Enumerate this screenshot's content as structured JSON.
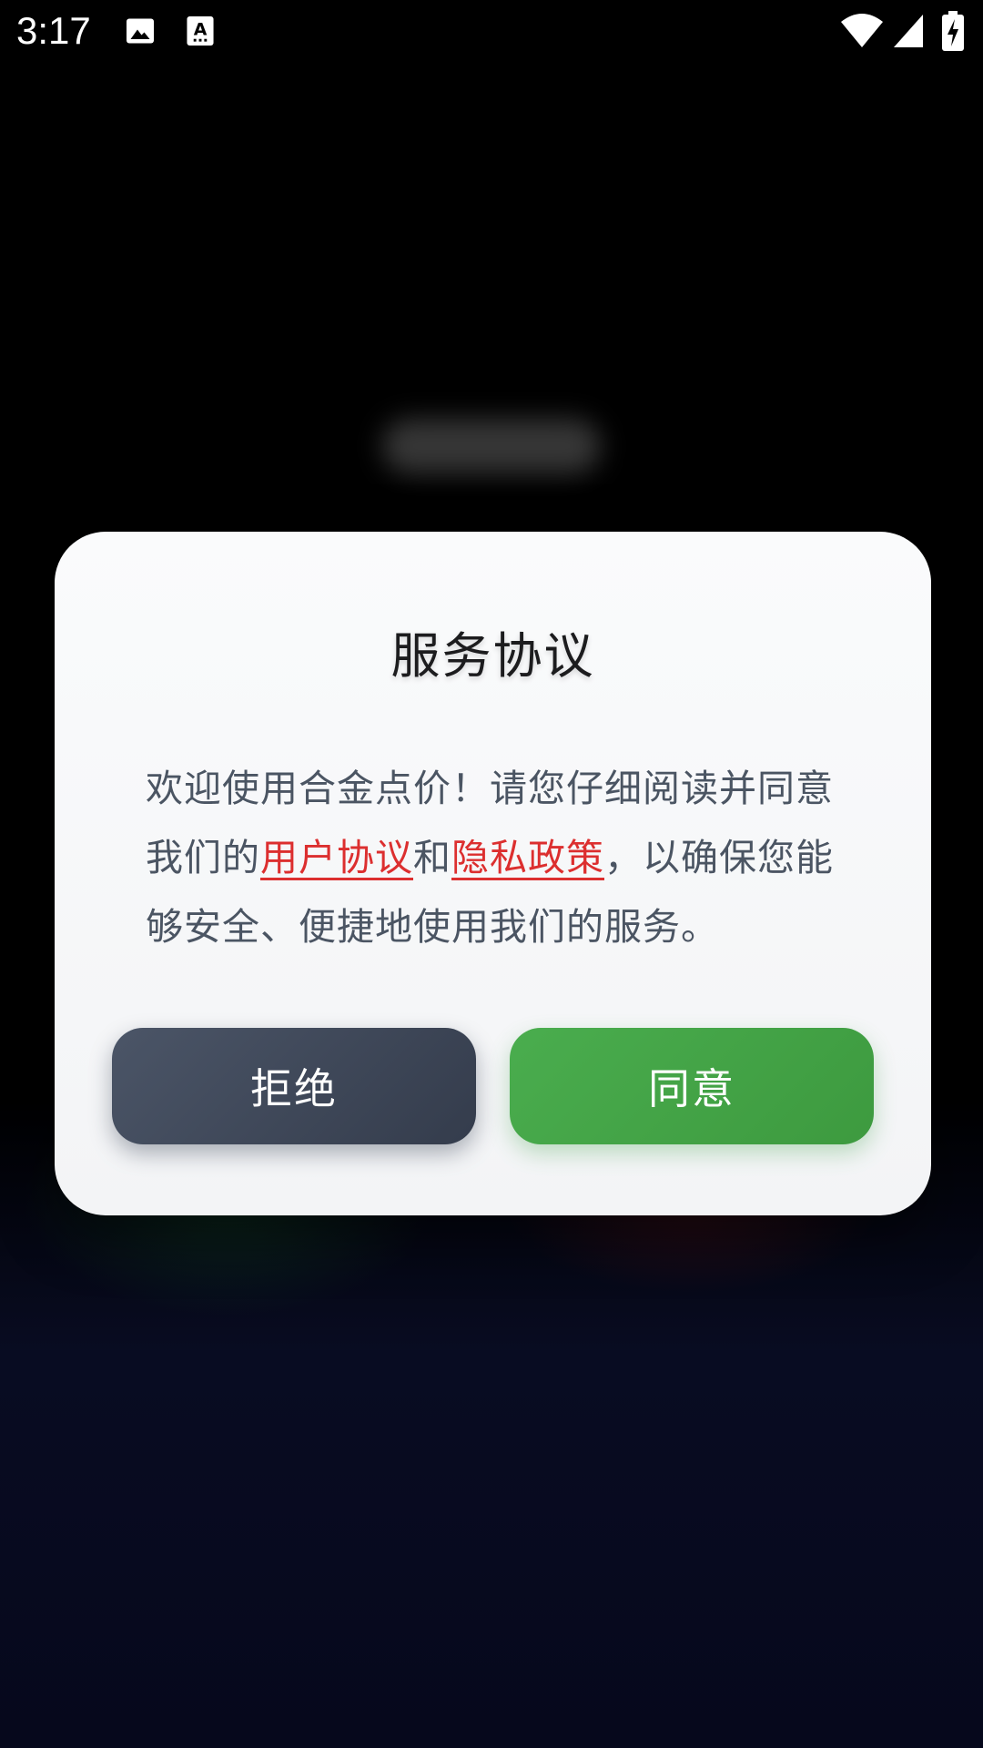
{
  "status_bar": {
    "time": "3:17",
    "icons": [
      "image-icon",
      "text-icon",
      "wifi-icon",
      "signal-icon",
      "battery-charging-icon"
    ]
  },
  "dialog": {
    "title": "服务协议",
    "body_part1": "欢迎使用合金点价！请您仔细阅读并同意我们的",
    "link_user_agreement": "用户协议",
    "body_and": "和",
    "link_privacy_policy": "隐私政策",
    "body_part2": "，以确保您能够安全、便捷地使用我们的服务。",
    "reject_label": "拒绝",
    "agree_label": "同意"
  },
  "colors": {
    "link": "#dc2f2f",
    "reject_button": "#3f4859",
    "agree_button": "#45a848"
  }
}
